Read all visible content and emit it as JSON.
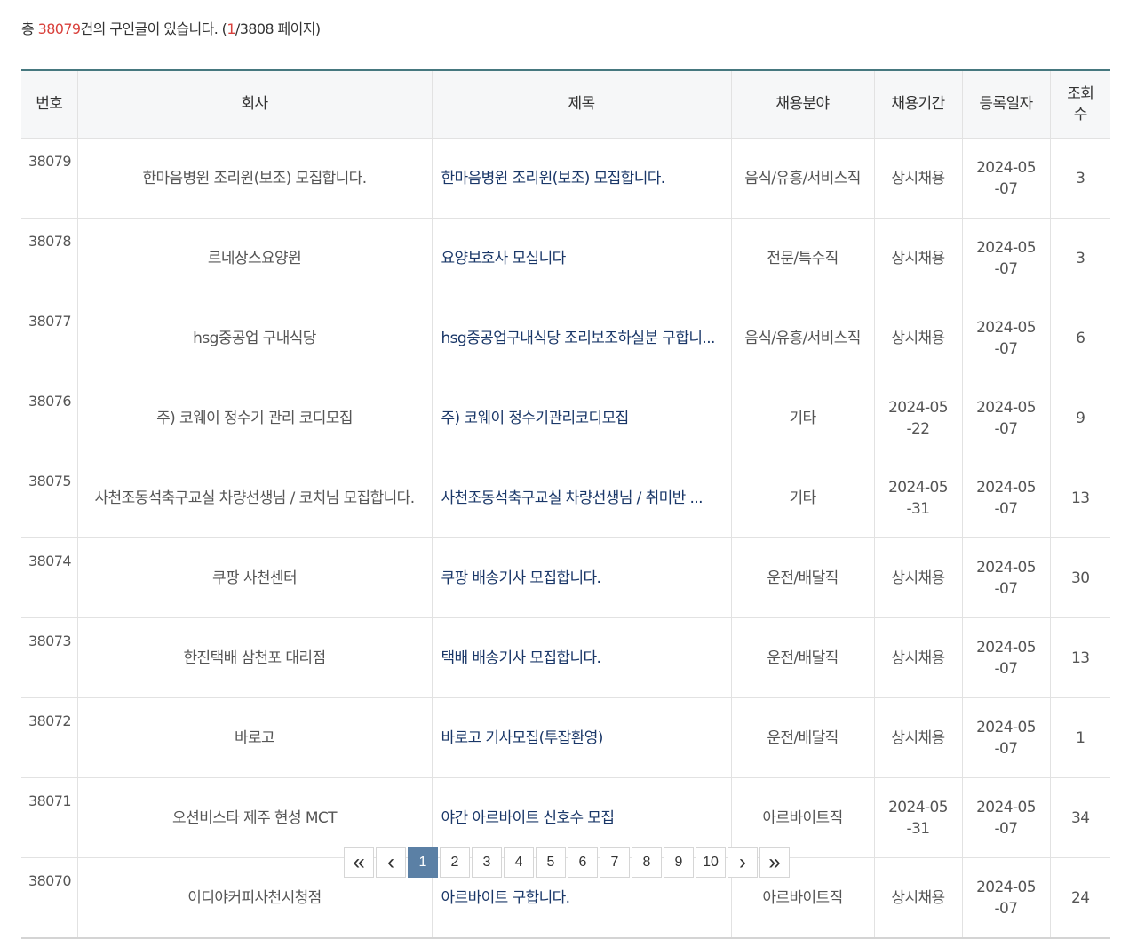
{
  "summary": {
    "prefix": "총 ",
    "total": "38079",
    "middle": "건의 구인글이 있습니다. (",
    "current_page": "1",
    "suffix": "/3808 페이지)"
  },
  "table": {
    "headers": [
      "번호",
      "회사",
      "제목",
      "채용분야",
      "채용기간",
      "등록일자",
      "조회수"
    ],
    "rows": [
      {
        "no": "38079",
        "company": "한마음병원 조리원(보조) 모집합니다.",
        "title": "한마음병원 조리원(보조) 모집합니다.",
        "field": "음식/유흥/서비스직",
        "period": "상시채용",
        "date": "2024-05-07",
        "views": "3"
      },
      {
        "no": "38078",
        "company": "르네상스요양원",
        "title": "요양보호사 모십니다",
        "field": "전문/특수직",
        "period": "상시채용",
        "date": "2024-05-07",
        "views": "3"
      },
      {
        "no": "38077",
        "company": "hsg중공업 구내식당",
        "title": "hsg중공업구내식당 조리보조하실분 구합니...",
        "field": "음식/유흥/서비스직",
        "period": "상시채용",
        "date": "2024-05-07",
        "views": "6"
      },
      {
        "no": "38076",
        "company": "주) 코웨이 정수기 관리 코디모집",
        "title": "주) 코웨이 정수기관리코디모집",
        "field": "기타",
        "period": "2024-05-22",
        "date": "2024-05-07",
        "views": "9"
      },
      {
        "no": "38075",
        "company": "사천조동석축구교실 차량선생님 / 코치님 모집합니다.",
        "title": "사천조동석축구교실 차량선생님 / 취미반 ...",
        "field": "기타",
        "period": "2024-05-31",
        "date": "2024-05-07",
        "views": "13"
      },
      {
        "no": "38074",
        "company": "쿠팡 사천센터",
        "title": "쿠팡 배송기사 모집합니다.",
        "field": "운전/배달직",
        "period": "상시채용",
        "date": "2024-05-07",
        "views": "30"
      },
      {
        "no": "38073",
        "company": "한진택배 삼천포 대리점",
        "title": "택배 배송기사 모집합니다.",
        "field": "운전/배달직",
        "period": "상시채용",
        "date": "2024-05-07",
        "views": "13"
      },
      {
        "no": "38072",
        "company": "바로고",
        "title": "바로고 기사모집(투잡환영)",
        "field": "운전/배달직",
        "period": "상시채용",
        "date": "2024-05-07",
        "views": "1"
      },
      {
        "no": "38071",
        "company": "오션비스타 제주 현성 MCT",
        "title": "야간 아르바이트 신호수 모집",
        "field": "아르바이트직",
        "period": "2024-05-31",
        "date": "2024-05-07",
        "views": "34"
      },
      {
        "no": "38070",
        "company": "이디야커피사천시청점",
        "title": "아르바이트 구합니다.",
        "field": "아르바이트직",
        "period": "상시채용",
        "date": "2024-05-07",
        "views": "24"
      }
    ]
  },
  "pagination": {
    "first": "«",
    "prev": "‹",
    "pages": [
      "1",
      "2",
      "3",
      "4",
      "5",
      "6",
      "7",
      "8",
      "9",
      "10"
    ],
    "active": "1",
    "next": "›",
    "last": "»"
  },
  "colors": {
    "accent_red": "#d9413c",
    "link_navy": "#1a3768",
    "header_border": "#46787f",
    "active_page": "#5b80a5"
  }
}
